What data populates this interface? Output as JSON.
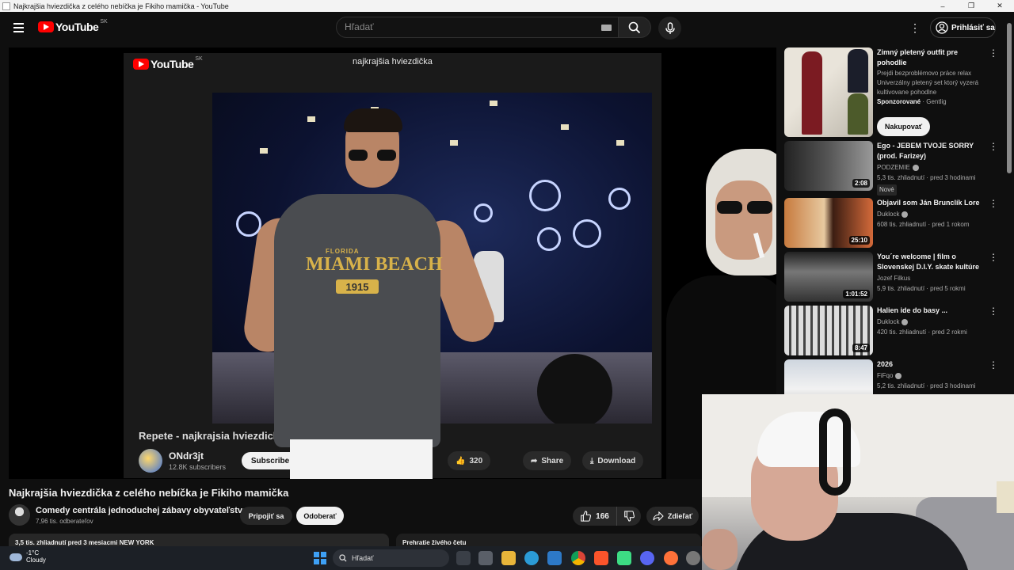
{
  "window": {
    "title": "Najkrajšia hviezdička z celého nebíčka je Fikiho mamička - YouTube",
    "minimize": "–",
    "maximize": "❐",
    "close": "✕"
  },
  "header": {
    "logo_text": "YouTube",
    "country_code": "SK",
    "search_placeholder": "Hľadať",
    "more": "⋮",
    "signin_label": "Prihlásiť sa"
  },
  "player": {
    "inner_logo_text": "YouTube",
    "inner_country_code": "SK",
    "inner_video_title": "najkrajšia hviezdička",
    "overlay_title": "Repete - najkrajsia hviezdick",
    "channel_name": "ONdr3jt",
    "channel_subs": "12.8K subscribers",
    "subscribe_label": "Subscribe",
    "like_count": "320",
    "share_label": "Share",
    "download_label": "Download",
    "shirt_line1": "FLORIDA",
    "shirt_line2": "MIAMI BEACH",
    "shirt_line3": "1915"
  },
  "video": {
    "title": "Najkrajšia hviezdička z celého nebíčka je Fikiho mamička",
    "channel_name": "Comedy centrála jednoduchej zábavy obyvateľstva",
    "channel_subs": "7,96 tis. odberateľov",
    "join_label": "Pripojiť sa",
    "subscribe_label": "Odoberať",
    "like_count": "166",
    "share_label": "Zdieľať",
    "desc_preview": "3,5 tis. zhliadnutí  pred 3 mesiacmi  NEW YORK",
    "chat_preview": "Prehratie živého četu"
  },
  "sidebar": {
    "ad": {
      "title": "Zimný pletený outfit pre pohodlie",
      "desc": "Prejdi bezproblémovo práce relax Univerzálny pletený set ktorý vyzerá kultivovane pohodlne",
      "sponsor_label": "Sponzorované",
      "advertiser": "Gentlig",
      "cta": "Nakupovať"
    },
    "items": [
      {
        "title": "Ego - JEBEM TVOJE SORRY (prod. Farizey)",
        "channel": "PODZEMIE",
        "meta": "5,3 tis. zhliadnutí · pred 3 hodinami",
        "duration": "2:08",
        "badge": "Nové"
      },
      {
        "title": "Objavil som Ján Brunclík Lore",
        "channel": "Duklock",
        "meta": "608 tis. zhliadnutí · pred 1 rokom",
        "duration": "25:10"
      },
      {
        "title": "You´re welcome | film o Slovenskej D.I.Y. skate kultúre",
        "channel": "Jozef Filkus",
        "meta": "5,9 tis. zhliadnutí · pred 5 rokmi",
        "duration": "1:01:52"
      },
      {
        "title": "Halien ide do basy ...",
        "channel": "Duklock",
        "meta": "420 tis. zhliadnutí · pred 2 rokmi",
        "duration": "8:47"
      },
      {
        "title": "2026",
        "channel": "FiFqo",
        "meta": "5,2 tis. zhliadnutí · pred 3 hodinami"
      }
    ]
  },
  "taskbar": {
    "temperature": "-1°C",
    "condition": "Cloudy",
    "search_label": "Hľadať"
  },
  "colors": {
    "yt_red": "#ff0000",
    "background": "#0f0f0f",
    "pill": "#272727"
  }
}
